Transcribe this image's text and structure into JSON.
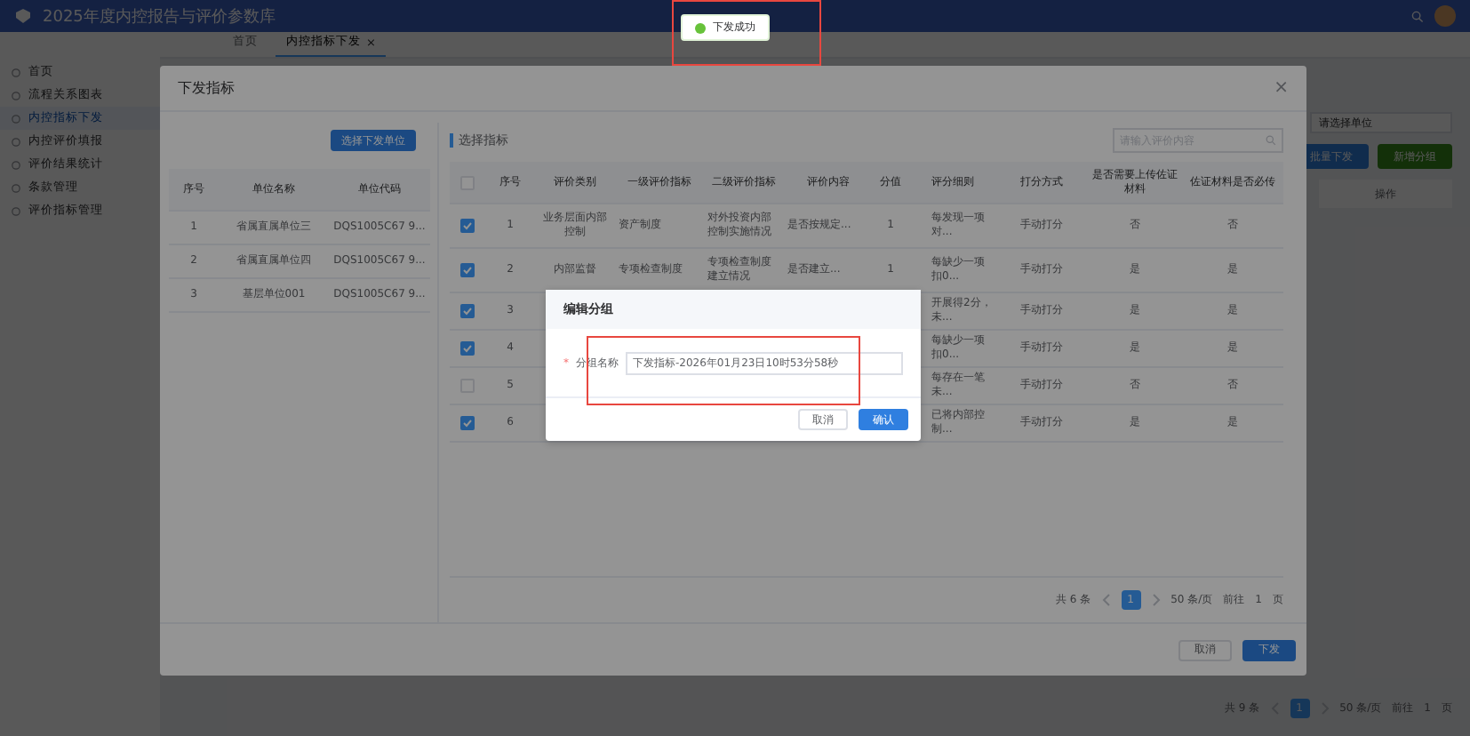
{
  "app": {
    "title": "2025年度内控报告与评价参数库",
    "sidebar": {
      "items": [
        {
          "label": "首页",
          "selected": false
        },
        {
          "label": "流程关系图表",
          "selected": false
        },
        {
          "label": "内控指标下发",
          "selected": true
        },
        {
          "label": "内控评价填报",
          "selected": false
        },
        {
          "label": "评价结果统计",
          "selected": false
        },
        {
          "label": "条款管理",
          "selected": false
        },
        {
          "label": "评价指标管理",
          "selected": false
        }
      ]
    },
    "tabs": [
      {
        "label": "首页",
        "selected": false
      },
      {
        "label": "内控指标下发",
        "selected": true,
        "close": "×"
      }
    ],
    "filter": {
      "placeholder": "请选择单位"
    },
    "buttons": [
      {
        "label": "批量下发",
        "kind": "primary"
      },
      {
        "label": "新增分组",
        "kind": "success"
      }
    ],
    "table": {
      "columns": [
        "操作"
      ]
    },
    "pagination": {
      "total": "共 9 条",
      "pages": [
        {
          "label": "1",
          "selected": true
        }
      ],
      "page_size": "50 条/页",
      "goto_label": "前往",
      "goto_value": "1",
      "goto_suffix": "页"
    }
  },
  "modal": {
    "title": "下发指标",
    "close": "×",
    "units": {
      "button": "选择下发单位",
      "columns": [
        "序号",
        "单位名称",
        "单位代码"
      ],
      "rows": [
        [
          "1",
          "省属直属单位三",
          "DQS1005C67 9..."
        ],
        [
          "2",
          "省属直属单位四",
          "DQS1005C67 9..."
        ],
        [
          "3",
          "基层单位001",
          "DQS1005C67 9..."
        ]
      ]
    },
    "indicators": {
      "label": "选择指标",
      "search": {
        "placeholder": "请输入评价内容"
      },
      "header_checked": false,
      "columns": [
        "序号",
        "评价类别",
        "一级评价指标",
        "二级评价指标",
        "评价内容",
        "分值",
        "评分细则",
        "打分方式",
        "是否需要上传佐证材料",
        "佐证材料是否必传"
      ],
      "rows": [
        {
          "checked": true,
          "cells": [
            "1",
            "业务层面内部控制",
            "资产制度",
            "对外投资内部控制实施情况",
            "是否按规定...",
            "1",
            "每发现一项对...",
            "手动打分",
            "否",
            "否"
          ]
        },
        {
          "checked": true,
          "cells": [
            "2",
            "内部监督",
            "专项检查制度",
            "专项检查制度建立情况",
            "是否建立...",
            "1",
            "每缺少一项扣0...",
            "手动打分",
            "是",
            "是"
          ]
        },
        {
          "checked": true,
          "cells": [
            "3",
            null,
            null,
            null,
            null,
            null,
            "开展得2分，未...",
            "手动打分",
            "是",
            "是"
          ]
        },
        {
          "checked": true,
          "cells": [
            "4",
            null,
            null,
            null,
            null,
            null,
            "每缺少一项扣0...",
            "手动打分",
            "是",
            "是"
          ]
        },
        {
          "checked": false,
          "cells": [
            "5",
            null,
            null,
            null,
            null,
            null,
            "每存在一笔未...",
            "手动打分",
            "否",
            "否"
          ]
        },
        {
          "checked": true,
          "cells": [
            "6",
            null,
            null,
            null,
            null,
            null,
            "已将内部控制...",
            "手动打分",
            "是",
            "是"
          ]
        }
      ],
      "pagination": {
        "total": "共 6 条",
        "pages": [
          {
            "label": "1",
            "selected": true
          }
        ],
        "page_size": "50 条/页",
        "goto_label": "前往",
        "goto_value": "1",
        "goto_suffix": "页"
      }
    },
    "buttons": [
      {
        "label": "取消",
        "kind": "default"
      },
      {
        "label": "下发",
        "kind": "primary"
      }
    ]
  },
  "dialog": {
    "title": "编辑分组",
    "field": {
      "label": "分组名称",
      "required_mark": "*",
      "value": "下发指标-2026年01月23日10时53分58秒"
    },
    "buttons": [
      {
        "label": "取消",
        "kind": "default"
      },
      {
        "label": "确认",
        "kind": "primary"
      }
    ]
  },
  "toast": {
    "message": "下发成功",
    "kind": "success"
  }
}
